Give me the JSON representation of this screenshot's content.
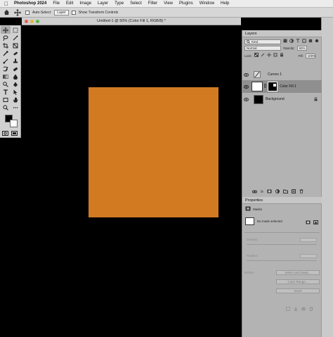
{
  "menubar": {
    "app": "Photoshop 2024",
    "items": [
      "File",
      "Edit",
      "Image",
      "Layer",
      "Type",
      "Select",
      "Filter",
      "View",
      "Plugins",
      "Window",
      "Help"
    ]
  },
  "options": {
    "auto_select_label": "Auto-Select:",
    "auto_select_value": "Layer",
    "transform_label": "Show Transform Controls"
  },
  "document": {
    "title": "Untitled-1 @ 50% (Color Fill 1, RGB/8) *",
    "fill_color": "#d17a22",
    "background_color": "#000000"
  },
  "layers": {
    "tab": "Layers",
    "kind": "Kind",
    "blend": "Normal",
    "opacity_label": "Opacity:",
    "opacity_value": "50%",
    "lock_label": "Lock:",
    "fill_label": "Fill:",
    "fill_value": "100%",
    "items": [
      {
        "name": "Curves 1"
      },
      {
        "name": "Color Fill 1"
      },
      {
        "name": "Background"
      }
    ]
  },
  "properties": {
    "tab": "Properties",
    "section": "Masks",
    "status": "No mask selected",
    "density_label": "Density:",
    "feather_label": "Feather:",
    "refine_label": "Refine:",
    "select_mask": "Select and Mask...",
    "color_range": "Color Range...",
    "invert": "Invert"
  },
  "colors": {
    "foreground": "#000000",
    "background": "#ffffff",
    "accent_fill": "#d17a22"
  }
}
